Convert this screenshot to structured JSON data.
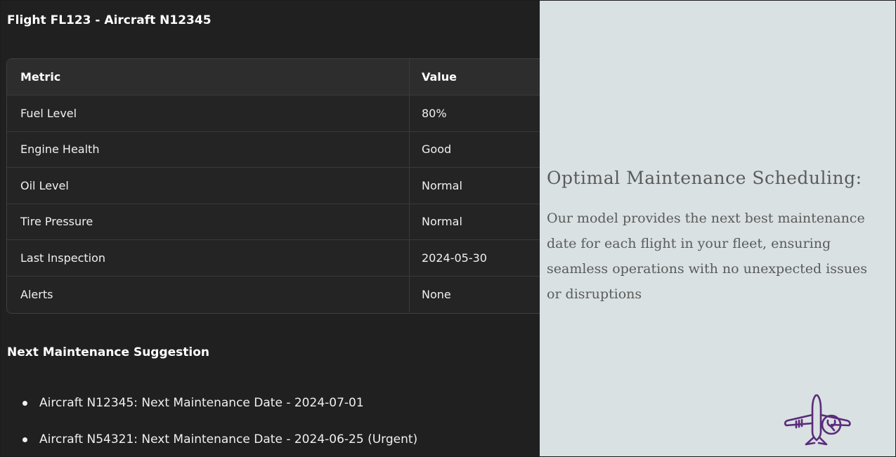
{
  "panel": {
    "title": "Flight FL123 - Aircraft N12345"
  },
  "table": {
    "headers": [
      "Metric",
      "Value"
    ],
    "rows": [
      {
        "metric": "Fuel Level",
        "value": "80%"
      },
      {
        "metric": "Engine Health",
        "value": "Good"
      },
      {
        "metric": "Oil Level",
        "value": "Normal"
      },
      {
        "metric": "Tire Pressure",
        "value": "Normal"
      },
      {
        "metric": "Last Inspection",
        "value": "2024-05-30"
      },
      {
        "metric": "Alerts",
        "value": "None"
      }
    ]
  },
  "suggestion": {
    "title": "Next Maintenance Suggestion",
    "items": [
      "Aircraft N12345: Next Maintenance Date - 2024-07-01",
      "Aircraft N54321: Next Maintenance Date - 2024-06-25 (Urgent)"
    ]
  },
  "promo": {
    "heading": "Optimal Maintenance Scheduling:",
    "text": "Our model provides the next best maintenance date for each flight in your fleet, ensuring seamless operations with no unexpected issues or disruptions",
    "icon": "plane-wrench-icon",
    "icon_color": "#5b2b7a"
  },
  "colors": {
    "panel_bg": "#202020",
    "right_bg": "#d9e1e2"
  }
}
